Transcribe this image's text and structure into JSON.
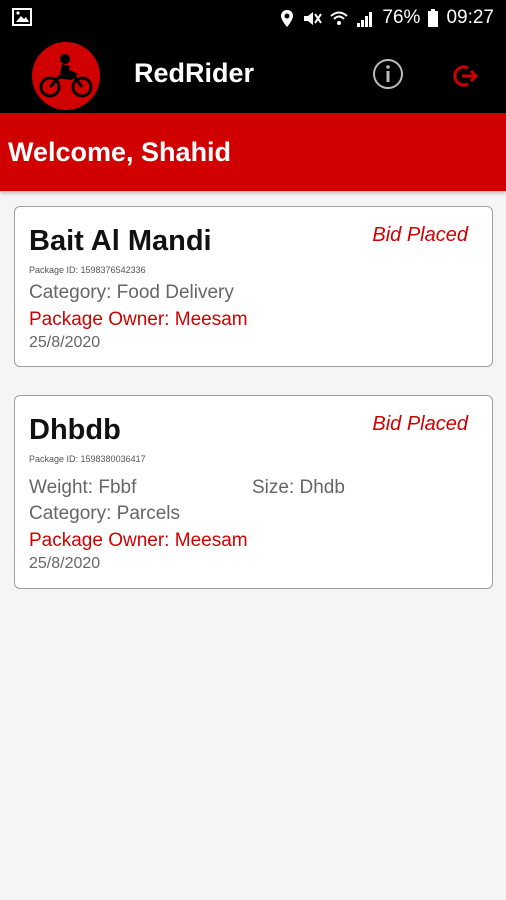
{
  "status_bar": {
    "battery": "76%",
    "time": "09:27",
    "icons": [
      "image-icon",
      "location-icon",
      "mute-icon",
      "wifi-icon",
      "signal-icon",
      "battery-icon"
    ]
  },
  "app_bar": {
    "title": "RedRider",
    "icons": [
      "motorcycle-logo",
      "info-icon",
      "logout-icon"
    ],
    "accent_color": "#d10000"
  },
  "welcome": {
    "text": "Welcome, Shahid"
  },
  "cards": [
    {
      "title": "Bait Al Mandi",
      "status": "Bid Placed",
      "package_id": "Package ID: 1598376542336",
      "category": "Category: Food Delivery",
      "owner": "Package Owner: Meesam",
      "date": "25/8/2020"
    },
    {
      "title": "Dhbdb",
      "status": "Bid Placed",
      "package_id": "Package ID: 1598380036417",
      "weight": "Weight: Fbbf",
      "size": "Size: Dhdb",
      "category": "Category: Parcels",
      "owner": "Package Owner: Meesam",
      "date": "25/8/2020"
    }
  ]
}
